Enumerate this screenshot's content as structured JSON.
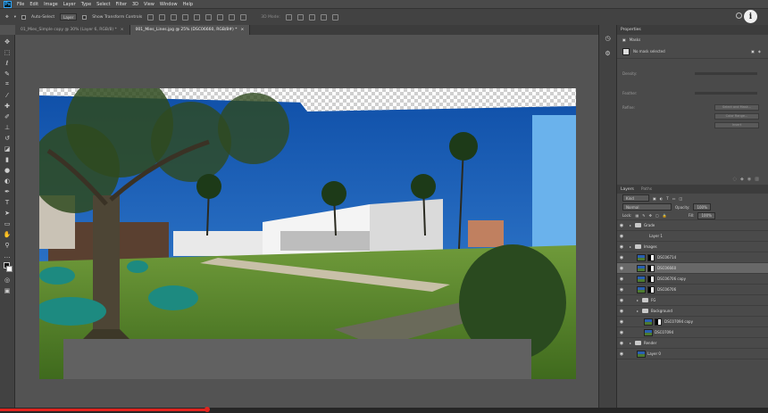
{
  "app": {
    "logo": "Ps"
  },
  "menu": [
    "File",
    "Edit",
    "Image",
    "Layer",
    "Type",
    "Select",
    "Filter",
    "3D",
    "View",
    "Window",
    "Help"
  ],
  "options": {
    "auto_select": "Auto-Select",
    "auto_select_value": "Layer",
    "show_transform": "Show Transform Controls",
    "mode_3d": "3D Mode:"
  },
  "tabs": [
    {
      "label": "01_Mies_Simple copy @ 30% (Layer 6, RGB/8) *"
    },
    {
      "label": "001_Mies_Lines.jpg @ 25% (DSC06660, RGB/8#) *"
    }
  ],
  "properties": {
    "tab": "Properties",
    "masks_label": "Masks",
    "no_mask": "No mask selected",
    "density": "Density:",
    "feather": "Feather:",
    "refine": "Refine:",
    "btn_select_mask": "Select and Mask...",
    "btn_color_range": "Color Range...",
    "btn_invert": "Invert"
  },
  "layers_panel": {
    "tabs": [
      "Layers",
      "Paths"
    ],
    "kind": "Kind",
    "blend_mode": "Normal",
    "opacity_label": "Opacity:",
    "opacity_value": "100%",
    "lock_label": "Lock:",
    "fill_label": "Fill:",
    "fill_value": "100%",
    "layers": [
      {
        "name": "Grade",
        "type": "group",
        "indent": 0,
        "selected": false,
        "mask": "none"
      },
      {
        "name": "Layer 1",
        "type": "plain",
        "indent": 1,
        "selected": false,
        "mask": "none"
      },
      {
        "name": "Images",
        "type": "group",
        "indent": 0,
        "selected": false,
        "mask": "none"
      },
      {
        "name": "DSC06714",
        "type": "image",
        "indent": 1,
        "selected": false,
        "mask": "half"
      },
      {
        "name": "DSC06660",
        "type": "image",
        "indent": 1,
        "selected": true,
        "mask": "half"
      },
      {
        "name": "DSC06706 copy",
        "type": "image",
        "indent": 1,
        "selected": false,
        "mask": "half"
      },
      {
        "name": "DSC06706",
        "type": "image",
        "indent": 1,
        "selected": false,
        "mask": "half"
      },
      {
        "name": "FG",
        "type": "group",
        "indent": 1,
        "selected": false,
        "mask": "none"
      },
      {
        "name": "Background",
        "type": "group",
        "indent": 1,
        "selected": false,
        "mask": "none"
      },
      {
        "name": "DSC07094 copy",
        "type": "image",
        "indent": 2,
        "selected": false,
        "mask": "half"
      },
      {
        "name": "DSC07094",
        "type": "image",
        "indent": 2,
        "selected": false,
        "mask": "none"
      },
      {
        "name": "Render",
        "type": "group",
        "indent": 0,
        "selected": false,
        "mask": "none"
      },
      {
        "name": "Layer 0",
        "type": "image",
        "indent": 1,
        "selected": false,
        "mask": "none"
      }
    ]
  },
  "video": {
    "progress": 0.27
  },
  "colors": {
    "accent_red": "#e0241e",
    "panel": "#4a4a4a",
    "selected_row": "#686868"
  }
}
